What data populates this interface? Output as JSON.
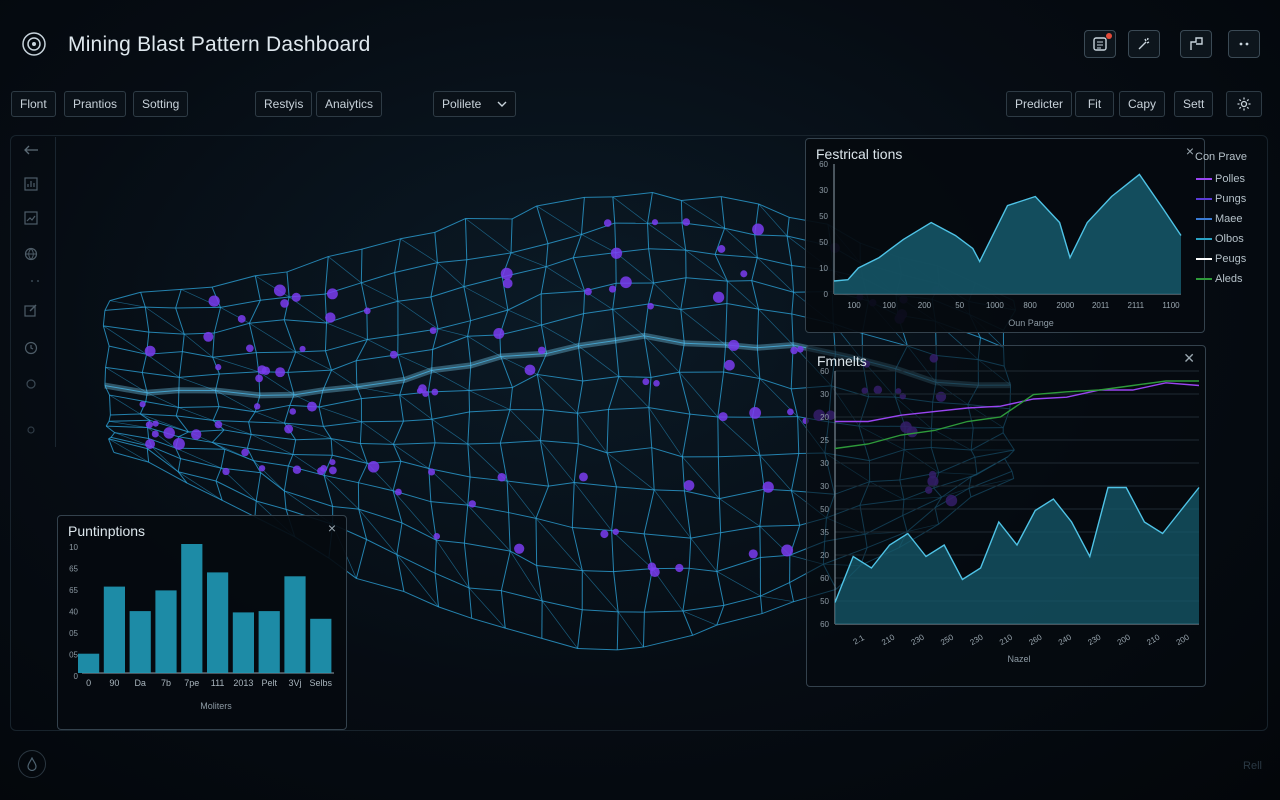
{
  "app": {
    "title": "Mining Blast Pattern Dashboard"
  },
  "header_actions": [
    {
      "icon": "notes-icon",
      "badge": true
    },
    {
      "icon": "magic-wand-icon"
    },
    {
      "icon": "split-view-icon"
    },
    {
      "icon": "more-icon"
    }
  ],
  "toolbar": {
    "left": [
      "Flont",
      "Prantios",
      "Sotting"
    ],
    "middle": [
      "Restyis",
      "Anaiytics"
    ],
    "select_value": "Polilete",
    "right": [
      "Predicter",
      "Fit",
      "Capy",
      "Sett"
    ],
    "settings_icon": "gear-icon"
  },
  "rail_icons": [
    "back-arrow-icon",
    "chart-icon",
    "image-icon",
    "globe-icon",
    "edit-icon",
    "clock-icon",
    "circle-icon",
    "dot-icon"
  ],
  "colors": {
    "mesh": "#2ea8e0",
    "nodes": "#7a3cf0",
    "area_fill": "#16596b",
    "area_line": "#4fc3e6",
    "purple_line": "#9a45f2",
    "green_line": "#2e9a3a"
  },
  "panel_rates": {
    "title": "Festrical tions",
    "close": "×",
    "legend_title": "Con Prave",
    "legend": [
      {
        "name": "Polles",
        "color": "#9a45f2"
      },
      {
        "name": "Pungs",
        "color": "#5b3bd6"
      },
      {
        "name": "Maee",
        "color": "#3a7bd5"
      },
      {
        "name": "Olbos",
        "color": "#2aa3c4"
      },
      {
        "name": "Peugs",
        "color": "#ffffff"
      },
      {
        "name": "Aleds",
        "color": "#2e9a3a"
      }
    ],
    "chart_data": {
      "type": "area",
      "y_ticks": [
        "60",
        "30",
        "50",
        "50",
        "10",
        "0"
      ],
      "x_ticks": [
        "100",
        "100",
        "200",
        "50",
        "1000",
        "800",
        "2000",
        "2011",
        "2111",
        "1100"
      ],
      "xlabel": "Oun Pange",
      "ylim": [
        0,
        100
      ],
      "values": [
        10,
        11,
        20,
        28,
        42,
        55,
        45,
        35,
        25,
        68,
        75,
        55,
        28,
        55,
        75,
        92,
        65,
        45,
        45
      ],
      "x_positions": [
        0.0,
        0.04,
        0.07,
        0.13,
        0.2,
        0.28,
        0.35,
        0.4,
        0.42,
        0.5,
        0.58,
        0.65,
        0.68,
        0.73,
        0.8,
        0.88,
        0.95,
        1.0,
        1.0
      ]
    }
  },
  "panel_fragments": {
    "title": "Fmnelts",
    "close": "✕",
    "chart_data": {
      "type": "line",
      "y_ticks": [
        "60",
        "30",
        "20",
        "25",
        "30",
        "30",
        "50",
        "35",
        "20",
        "60",
        "50",
        "60"
      ],
      "x_ticks": [
        "2.1",
        "210",
        "230",
        "250",
        "230",
        "210",
        "260",
        "240",
        "230",
        "200",
        "210",
        "200"
      ],
      "xlabel": "Nazel",
      "ylim": [
        0,
        100
      ],
      "series": [
        {
          "name": "",
          "color": "#9a45f2",
          "values": [
            55,
            55,
            62,
            66,
            70,
            72,
            80,
            82,
            90,
            90,
            98,
            95
          ]
        },
        {
          "name": "",
          "color": "#2e9a3a",
          "values": [
            25,
            30,
            40,
            45,
            55,
            60,
            85,
            88,
            90,
            95,
            100,
            100
          ]
        }
      ],
      "area": [
        5,
        25,
        20,
        30,
        35,
        25,
        30,
        15,
        20,
        40,
        30,
        45,
        50,
        40,
        25,
        55,
        55,
        40,
        35,
        45,
        55
      ]
    }
  },
  "panel_bars": {
    "title": "Puntinptions",
    "close": "×",
    "chart_data": {
      "type": "bar",
      "categories": [
        "0",
        "90",
        "Da",
        "7b",
        "7pe",
        "111",
        "2013",
        "Pelt",
        "3Vj",
        "Selbs"
      ],
      "values": [
        15,
        67,
        48,
        64,
        100,
        78,
        47,
        48,
        75,
        42
      ],
      "y_ticks": [
        "10",
        "65",
        "65",
        "40",
        "05",
        "05",
        "0"
      ],
      "xlabel": "Moliters",
      "ylim": [
        0,
        100
      ]
    }
  },
  "footer": {
    "text": "Rell"
  }
}
